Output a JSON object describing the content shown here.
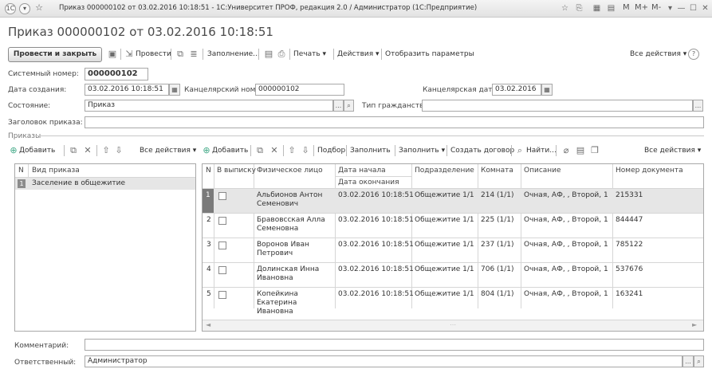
{
  "window": {
    "title": "Приказ 000000102 от 03.02.2016 10:18:51 - 1С:Университет ПРОФ, редакция 2.0 / Администратор  (1С:Предприятие)",
    "memory_buttons": [
      "M",
      "M+",
      "M-"
    ]
  },
  "page_title": "Приказ 000000102 от 03.02.2016 10:18:51",
  "toolbar": {
    "post_close": "Провести и закрыть",
    "post": "Провести",
    "fill": "Заполнение...",
    "print": "Печать",
    "actions": "Действия",
    "show_params": "Отобразить параметры",
    "all_actions": "Все действия",
    "help": "?"
  },
  "form": {
    "system_number_label": "Системный номер:",
    "system_number": "000000102",
    "created_label": "Дата создания:",
    "created": "03.02.2016 10:18:51",
    "office_number_label": "Канцелярский номер:",
    "office_number": "000000102",
    "office_date_label": "Канцелярская дата:",
    "office_date": "03.02.2016",
    "state_label": "Состояние:",
    "state": "Приказ",
    "citizenship_label": "Тип гражданства:",
    "citizenship": "",
    "heading_label": "Заголовок приказа:",
    "heading": "",
    "section_label": "Приказы",
    "comment_label": "Комментарий:",
    "comment": "",
    "responsible_label": "Ответственный:",
    "responsible": "Администратор"
  },
  "left_toolbar": {
    "add": "Добавить",
    "all_actions": "Все действия"
  },
  "right_toolbar": {
    "add": "Добавить",
    "pick": "Подбор",
    "fill": "Заполнить",
    "fill_menu": "Заполнить",
    "create_contract": "Создать договор",
    "find": "Найти...",
    "all_actions": "Все действия"
  },
  "left_table": {
    "headers": [
      "N",
      "Вид приказа"
    ],
    "rows": [
      {
        "n": "1",
        "kind": "Заселение в общежитие"
      }
    ]
  },
  "right_table": {
    "headers": {
      "n": "N",
      "extract": "В выписку",
      "person": "Физическое лицо",
      "start": "Дата начала",
      "end": "Дата окончания",
      "dept": "Подразделение",
      "room": "Комната",
      "desc": "Описание",
      "doc": "Номер документа"
    },
    "rows": [
      {
        "n": "1",
        "person": "Альбионов Антон Семенович",
        "start": "03.02.2016 10:18:51",
        "dept": "Общежитие 1/1",
        "room": "214 (1/1)",
        "desc": "Очная, АФ, , Второй, 1",
        "doc": "215331"
      },
      {
        "n": "2",
        "person": "Бравовсская Алла Семеновна",
        "start": "03.02.2016 10:18:51",
        "dept": "Общежитие 1/1",
        "room": "225 (1/1)",
        "desc": "Очная, АФ, , Второй, 1",
        "doc": "844447"
      },
      {
        "n": "3",
        "person": "Воронов Иван Петрович",
        "start": "03.02.2016 10:18:51",
        "dept": "Общежитие 1/1",
        "room": "237 (1/1)",
        "desc": "Очная, АФ, , Второй, 1",
        "doc": "785122"
      },
      {
        "n": "4",
        "person": "Долинская Инна Ивановна",
        "start": "03.02.2016 10:18:51",
        "dept": "Общежитие 1/1",
        "room": "706 (1/1)",
        "desc": "Очная, АФ, , Второй, 1",
        "doc": "537676"
      },
      {
        "n": "5",
        "person": "Копейкина Екатерина Ивановна",
        "start": "03.02.2016 10:18:51",
        "dept": "Общежитие 1/1",
        "room": "804 (1/1)",
        "desc": "Очная, АФ, , Второй, 1",
        "doc": "163241"
      }
    ]
  },
  "colors": {
    "selected_row": "#e6e6e6",
    "current_marker": "#7a7a7a",
    "title_bar": "#ececec"
  }
}
